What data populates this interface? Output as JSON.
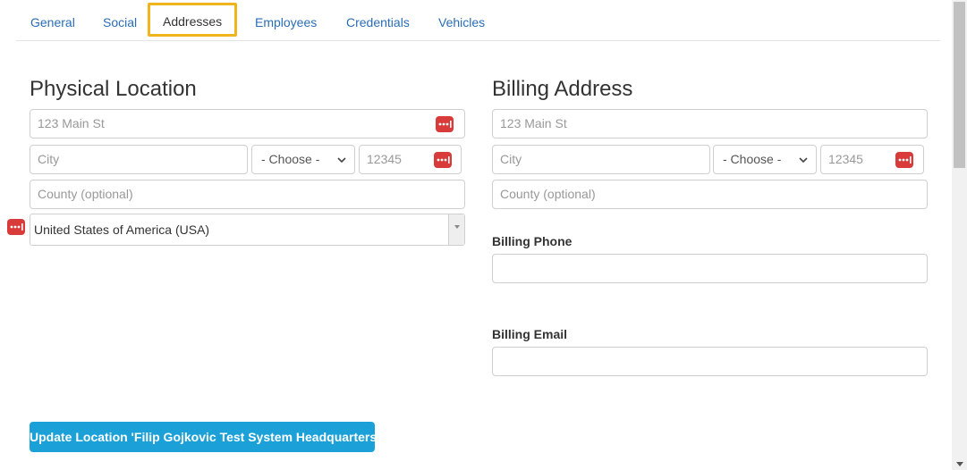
{
  "tabs": [
    {
      "label": "General"
    },
    {
      "label": "Social"
    },
    {
      "label": "Addresses"
    },
    {
      "label": "Employees"
    },
    {
      "label": "Credentials"
    },
    {
      "label": "Vehicles"
    }
  ],
  "active_tab": "Addresses",
  "physical": {
    "title": "Physical Location",
    "street_placeholder": "123 Main St",
    "city_placeholder": "City",
    "state_selected": "- Choose -",
    "zip_placeholder": "12345",
    "county_placeholder": "County (optional)",
    "country_selected": "United States of America (USA)"
  },
  "billing": {
    "title": "Billing Address",
    "street_placeholder": "123 Main St",
    "city_placeholder": "City",
    "state_selected": "- Choose -",
    "zip_placeholder": "12345",
    "county_placeholder": "County (optional)",
    "phone_label": "Billing Phone",
    "email_label": "Billing Email"
  },
  "update_button_label": "Update Location 'Filip Gojkovic Test System Headquarters'",
  "colors": {
    "link": "#2a6db5",
    "active_tab_border": "#f0b41c",
    "button_bg": "#1ba1d8",
    "password_icon": "#d93a3a"
  },
  "icons": [
    "password-manager-icon",
    "chevron-down-icon",
    "dropdown-arrow-icon"
  ]
}
